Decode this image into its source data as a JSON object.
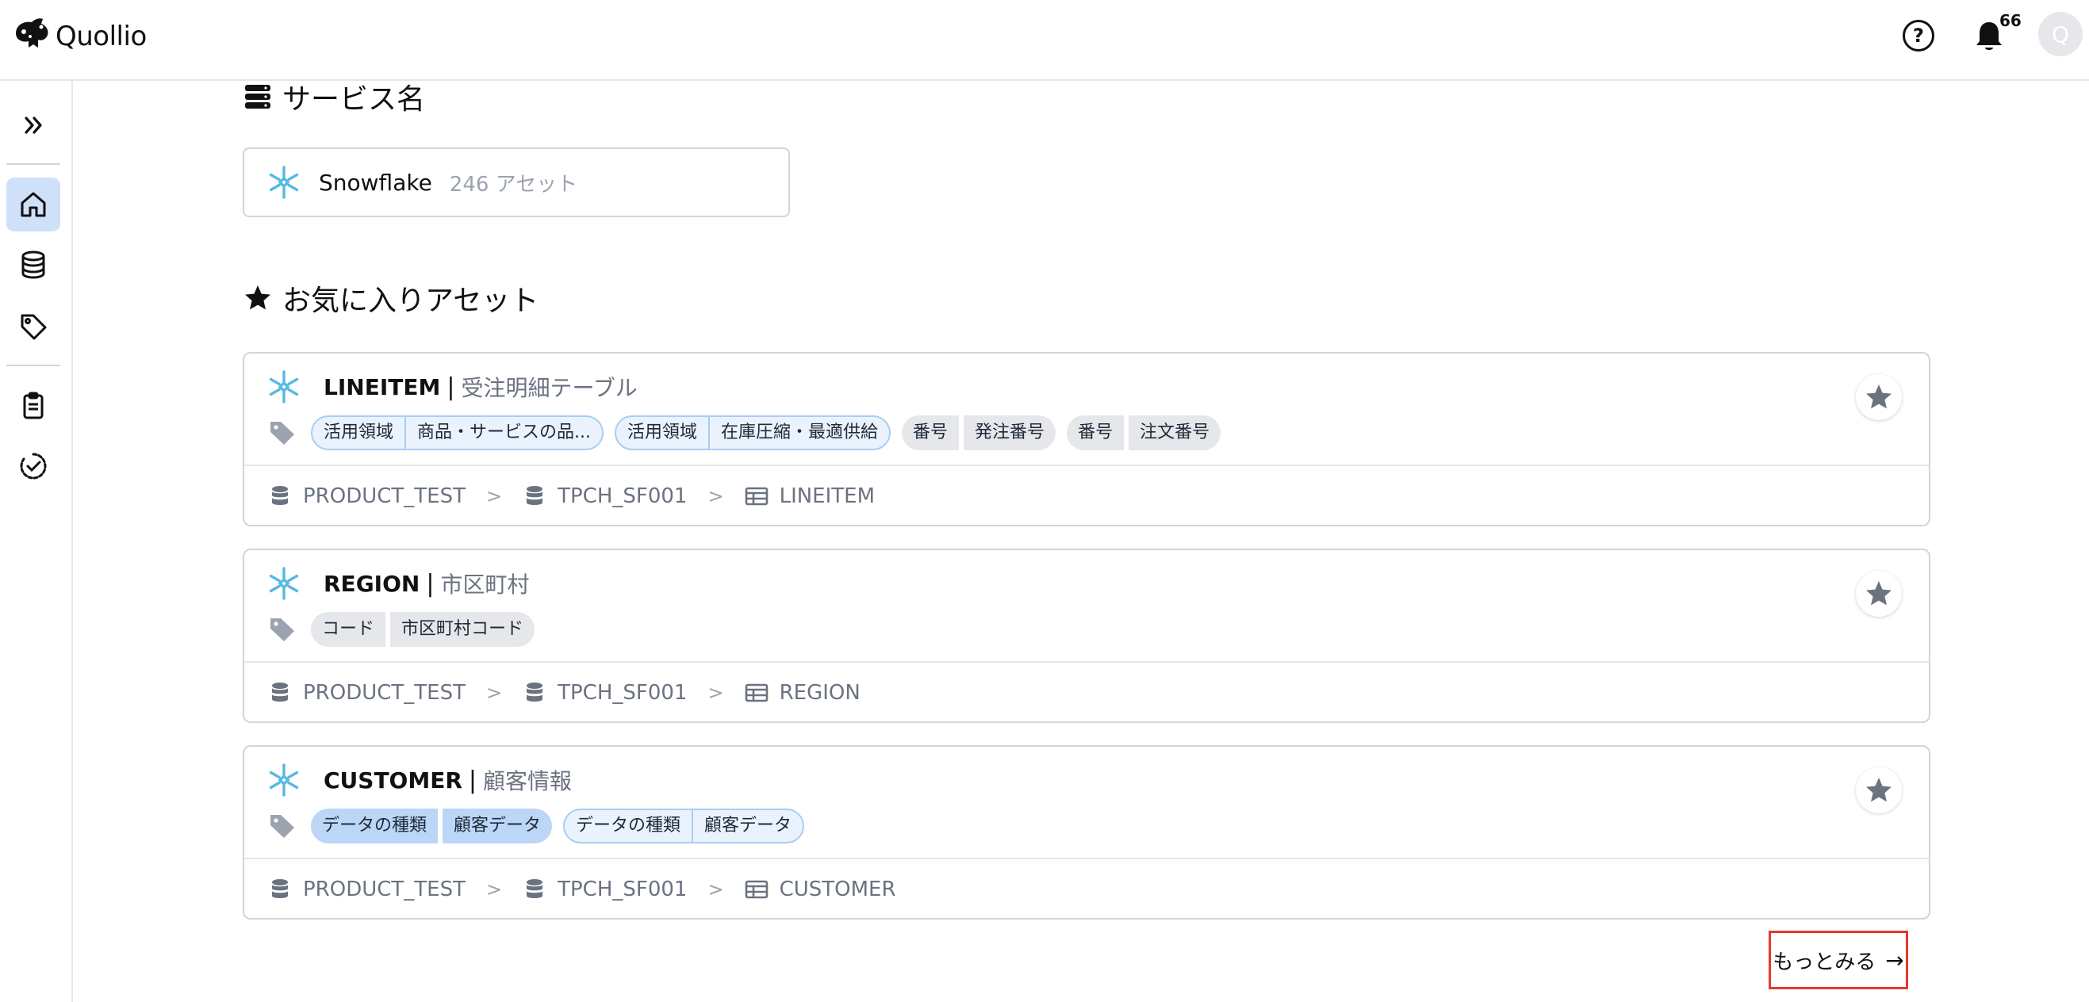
{
  "header": {
    "logo_text": "Quollio",
    "notification_count": "66",
    "avatar_initial": "Q"
  },
  "services_section": {
    "title": "サービス名",
    "services": [
      {
        "name": "Snowflake",
        "count": "246 アセット"
      }
    ]
  },
  "favorites_section": {
    "title": "お気に入りアセット",
    "assets": [
      {
        "name": "LINEITEM",
        "separator": "|",
        "logical_name": "受注明細テーブル",
        "tag_groups": [
          {
            "style": "outline",
            "tags": [
              "活用領域",
              "商品・サービスの品..."
            ]
          },
          {
            "style": "outline",
            "tags": [
              "活用領域",
              "在庫圧縮・最適供給"
            ]
          },
          {
            "style": "gray",
            "tags": [
              "番号",
              "発注番号"
            ]
          },
          {
            "style": "gray",
            "tags": [
              "番号",
              "注文番号"
            ]
          }
        ],
        "path": [
          "PRODUCT_TEST",
          "TPCH_SF001",
          "LINEITEM"
        ]
      },
      {
        "name": "REGION",
        "separator": "|",
        "logical_name": "市区町村",
        "tag_groups": [
          {
            "style": "gray",
            "tags": [
              "コード",
              "市区町村コード"
            ]
          }
        ],
        "path": [
          "PRODUCT_TEST",
          "TPCH_SF001",
          "REGION"
        ]
      },
      {
        "name": "CUSTOMER",
        "separator": "|",
        "logical_name": "顧客情報",
        "tag_groups": [
          {
            "style": "blue",
            "tags": [
              "データの種類",
              "顧客データ"
            ]
          },
          {
            "style": "outline",
            "tags": [
              "データの種類",
              "顧客データ"
            ]
          }
        ],
        "path": [
          "PRODUCT_TEST",
          "TPCH_SF001",
          "CUSTOMER"
        ]
      }
    ]
  },
  "more_button": {
    "label": "もっとみる",
    "arrow": "→"
  },
  "icons": {
    "logo": "quollio-logo-icon",
    "help": "help-circle-icon",
    "bell": "bell-icon",
    "expand": "chevrons-right-icon",
    "home": "home-icon",
    "database": "database-icon",
    "tag": "tag-icon",
    "clipboard": "clipboard-icon",
    "check": "check-circle-icon",
    "star": "star-icon",
    "snowflake": "snowflake-icon",
    "table": "table-icon",
    "chevron": "chevron-right-icon"
  },
  "colors": {
    "active_nav": "#cfe0fa",
    "snowflake": "#56b9e3",
    "highlight_border": "#e23b2e"
  }
}
